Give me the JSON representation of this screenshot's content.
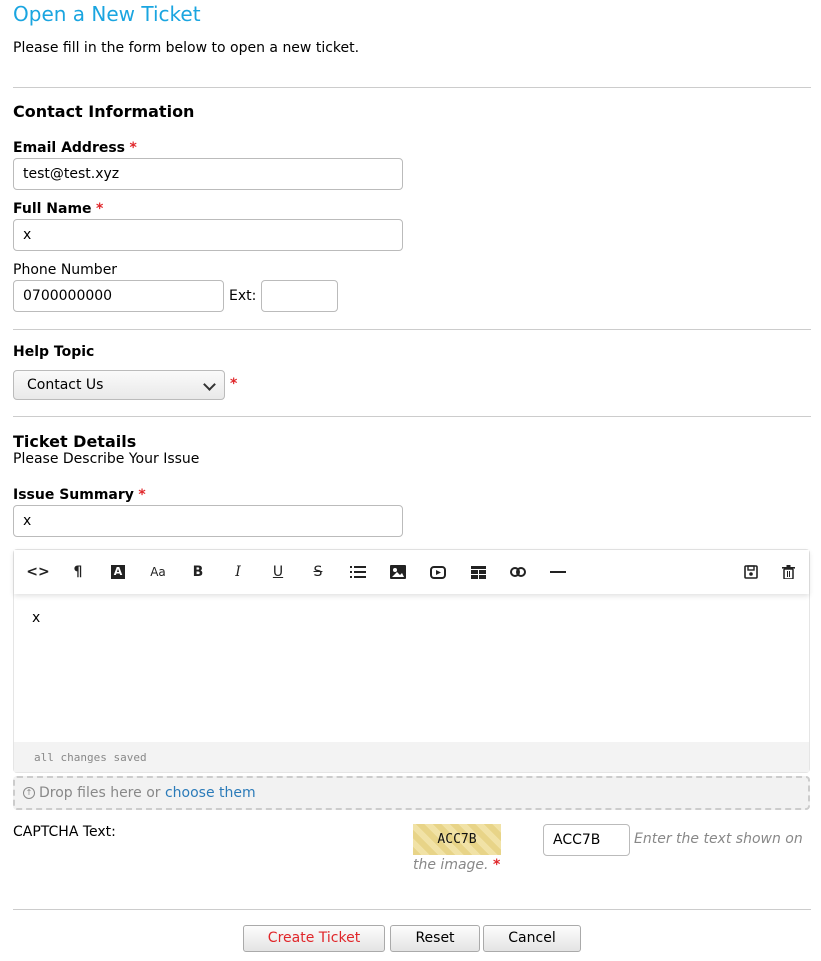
{
  "header": {
    "title": "Open a New Ticket",
    "intro": "Please fill in the form below to open a new ticket."
  },
  "contact": {
    "section_title": "Contact Information",
    "email_label": "Email Address",
    "email_value": "test@test.xyz",
    "name_label": "Full Name",
    "name_value": "x",
    "phone_label": "Phone Number",
    "phone_value": "0700000000",
    "ext_label": "Ext:",
    "ext_value": "",
    "required_mark": "*"
  },
  "help_topic": {
    "section_title": "Help Topic",
    "selected": "Contact Us",
    "required_mark": "*"
  },
  "ticket": {
    "section_title": "Ticket Details",
    "subtitle": "Please Describe Your Issue",
    "summary_label": "Issue Summary",
    "summary_value": "x",
    "required_mark": "*"
  },
  "editor": {
    "body_text": "x",
    "status": "all changes saved",
    "toolbar": {
      "html": "<>",
      "paragraph": "¶",
      "font_color": "A",
      "font_size": "Aa",
      "bold": "B",
      "italic": "I",
      "underline": "U",
      "strike": "S"
    },
    "icons": [
      "code-icon",
      "paragraph-icon",
      "font-color-icon",
      "font-size-icon",
      "bold-icon",
      "italic-icon",
      "underline-icon",
      "strikethrough-icon",
      "list-icon",
      "image-icon",
      "video-icon",
      "table-icon",
      "link-icon",
      "horizontal-rule-icon",
      "save-icon",
      "trash-icon"
    ]
  },
  "dropzone": {
    "text": "Drop files here or",
    "link": "choose them"
  },
  "captcha": {
    "label": "CAPTCHA Text:",
    "image_text": "ACC7B",
    "value": "ACC7B",
    "hint_line1": "Enter the text shown on",
    "hint_line2": "the image.",
    "required_mark": "*"
  },
  "buttons": {
    "create": "Create Ticket",
    "reset": "Reset",
    "cancel": "Cancel"
  },
  "colors": {
    "title": "#1aa5e0",
    "required": "#e0262a",
    "create_button_text": "#e0262a",
    "link": "#2b7bb9"
  }
}
